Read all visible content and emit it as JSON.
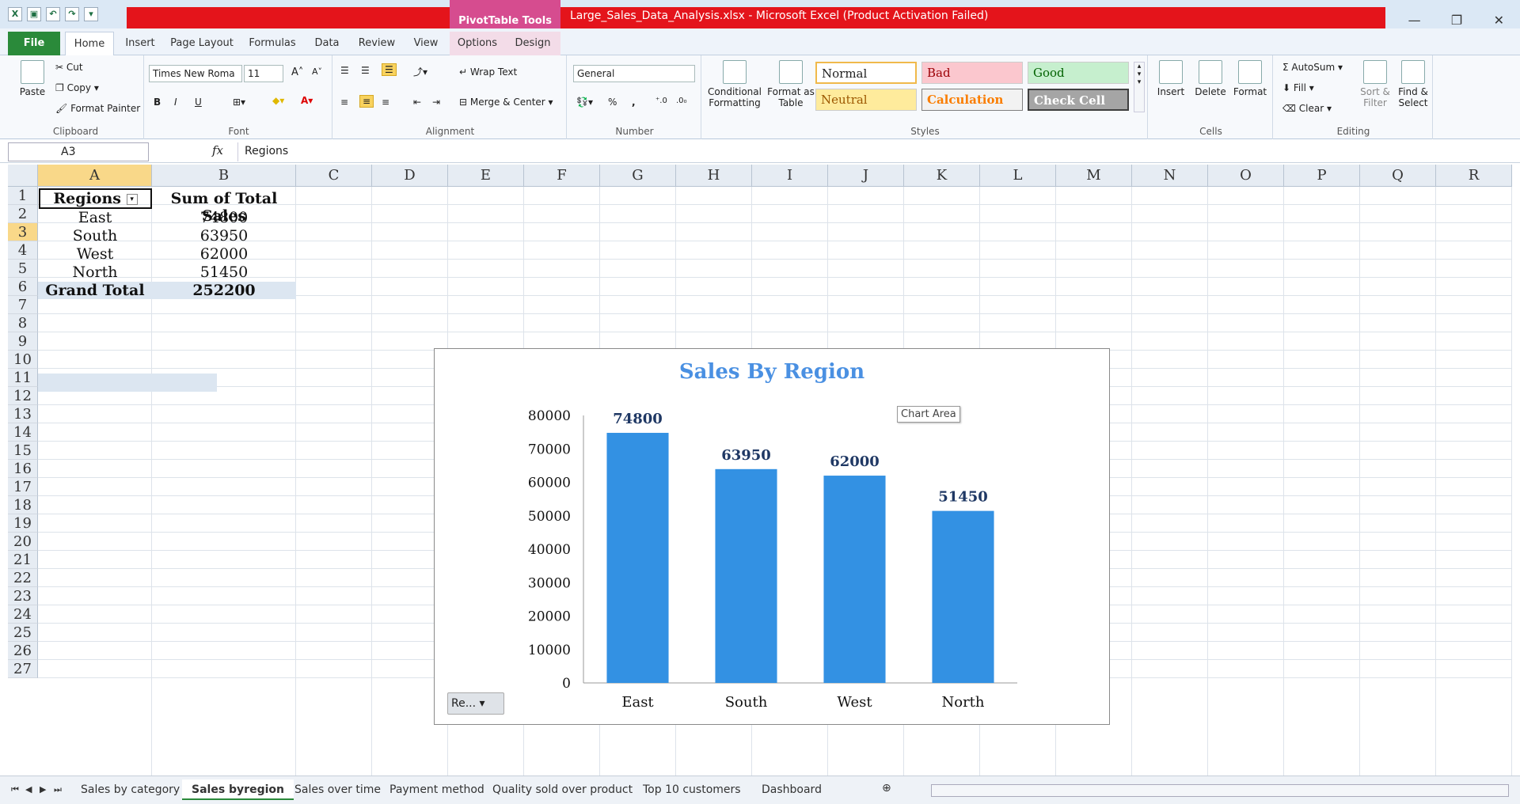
{
  "window": {
    "title": "Large_Sales_Data_Analysis.xlsx - Microsoft Excel (Product Activation Failed)",
    "context_tab": "PivotTable Tools",
    "buttons": [
      "—",
      "❐",
      "✕"
    ]
  },
  "ribbon_tabs": [
    "File",
    "Home",
    "Insert",
    "Page Layout",
    "Formulas",
    "Data",
    "Review",
    "View",
    "Options",
    "Design"
  ],
  "ribbon": {
    "clipboard": {
      "paste": "Paste",
      "cut": "Cut",
      "copy": "Copy",
      "format_painter": "Format Painter",
      "label": "Clipboard"
    },
    "font": {
      "name": "Times New Roma",
      "size": "11",
      "bold": "B",
      "italic": "I",
      "underline": "U",
      "label": "Font"
    },
    "alignment": {
      "wrap": "Wrap Text",
      "merge": "Merge & Center",
      "label": "Alignment"
    },
    "number": {
      "format": "General",
      "percent": "%",
      "comma": ",",
      "label": "Number"
    },
    "styles": {
      "conditional": "Conditional Formatting",
      "format_table": "Format as Table",
      "normal": "Normal",
      "bad": "Bad",
      "good": "Good",
      "neutral": "Neutral",
      "calculation": "Calculation",
      "check": "Check Cell",
      "label": "Styles"
    },
    "cells": {
      "insert": "Insert",
      "delete": "Delete",
      "format": "Format",
      "label": "Cells"
    },
    "editing": {
      "autosum": "AutoSum",
      "fill": "Fill",
      "clear": "Clear",
      "sort": "Sort & Filter",
      "find": "Find & Select",
      "label": "Editing"
    }
  },
  "formula_bar": {
    "name_box": "A3",
    "fx": "fx",
    "value": "Regions"
  },
  "columns": [
    "A",
    "B",
    "C",
    "D",
    "E",
    "F",
    "G",
    "H",
    "I",
    "J",
    "K",
    "L",
    "M",
    "N",
    "O",
    "P",
    "Q",
    "R"
  ],
  "rows": [
    "1",
    "2",
    "3",
    "4",
    "5",
    "6",
    "7",
    "8",
    "9",
    "10",
    "11",
    "12",
    "13",
    "14",
    "15",
    "16",
    "17",
    "18",
    "19",
    "20",
    "21",
    "22",
    "23",
    "24",
    "25",
    "26",
    "27"
  ],
  "pivot": {
    "header_a": "Regions",
    "header_b": "Sum of Total Sales",
    "rows": [
      {
        "region": "East",
        "sales": "74800"
      },
      {
        "region": "South",
        "sales": "63950"
      },
      {
        "region": "West",
        "sales": "62000"
      },
      {
        "region": "North",
        "sales": "51450"
      }
    ],
    "total_label": "Grand Total",
    "total_value": "252200"
  },
  "chart_tooltip": "Chart Area",
  "field_button": "Re...",
  "chart_data": {
    "type": "bar",
    "title": "Sales By Region",
    "categories": [
      "East",
      "South",
      "West",
      "North"
    ],
    "values": [
      74800,
      63950,
      62000,
      51450
    ],
    "ylim": [
      0,
      80000
    ],
    "yticks": [
      "0",
      "10000",
      "20000",
      "30000",
      "40000",
      "50000",
      "60000",
      "70000",
      "80000"
    ],
    "bar_color": "#3391e3",
    "title_color": "#4a90e2",
    "grid": false,
    "legend": "none"
  },
  "sheet_tabs": [
    "Sales  by category",
    "Sales byregion",
    "Sales over time",
    "Payment method",
    "Quality sold over product",
    "Top 10 customers",
    "Dashboard"
  ],
  "active_sheet": "Sales byregion"
}
